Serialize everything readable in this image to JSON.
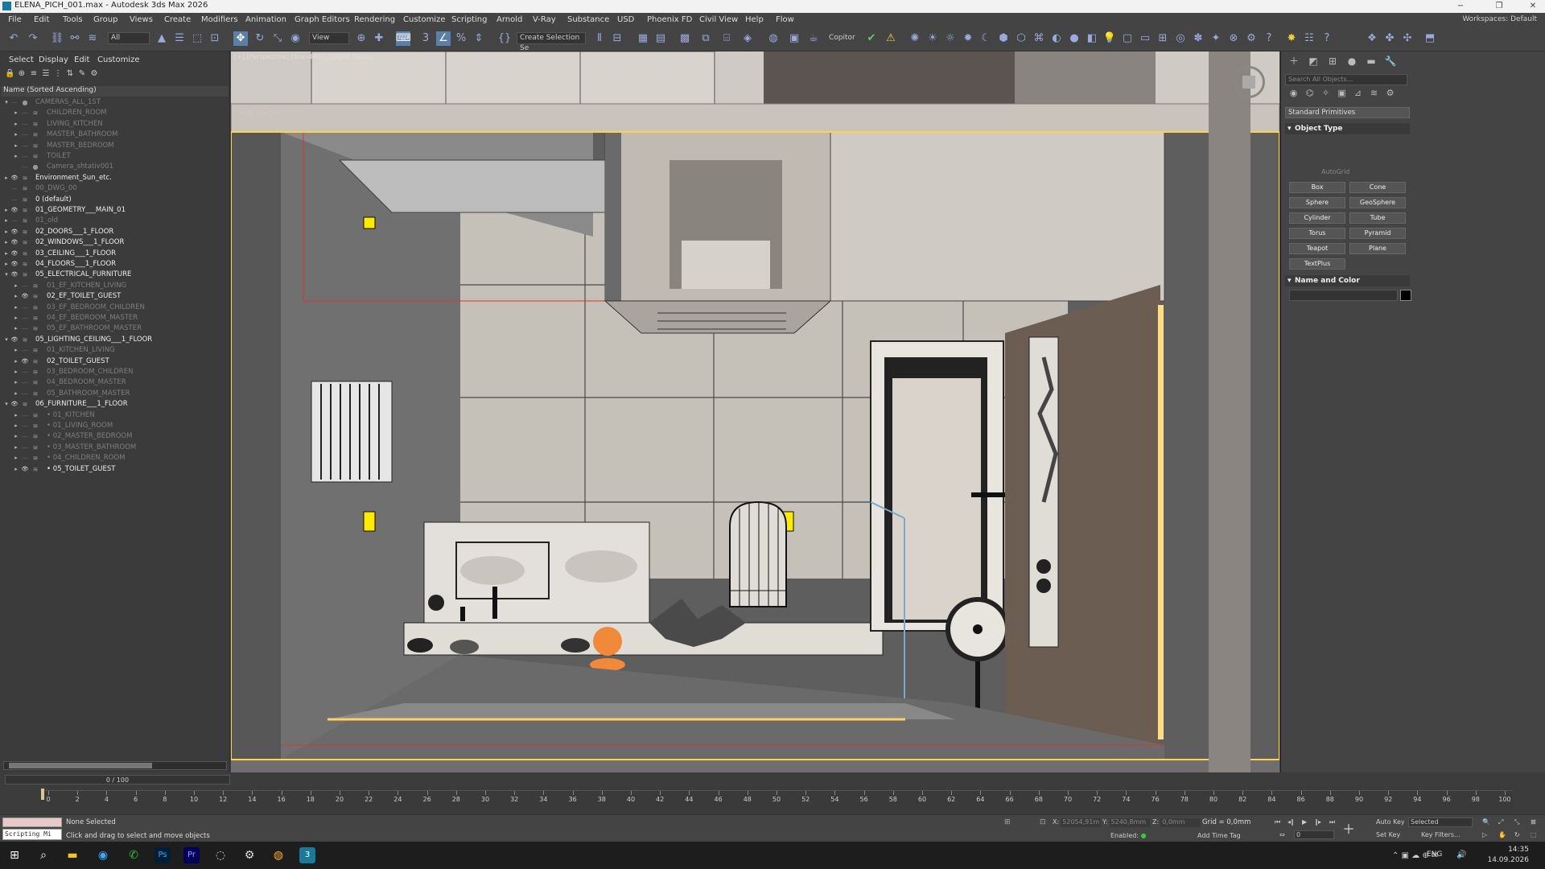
{
  "window": {
    "title": "ELENA_PICH_001.max - Autodesk 3ds Max 2026",
    "minimize": "−",
    "restore": "❐",
    "close": "✕"
  },
  "menu": [
    "File",
    "Edit",
    "Tools",
    "Group",
    "Views",
    "Create",
    "Modifiers",
    "Animation",
    "Graph Editors",
    "Rendering",
    "Customize",
    "Scripting",
    "Arnold",
    "V-Ray",
    "Substance",
    "USD",
    "Phoenix FD",
    "Civil View",
    "Help",
    "Flow"
  ],
  "workspace": {
    "label": "Workspaces:",
    "value": "Default"
  },
  "toolbar": {
    "selection_filter": "All",
    "ref_coord": "View",
    "named_selection": "Create Selection Se",
    "copitor": "Copitor"
  },
  "scene_explorer": {
    "tabs": [
      "Select",
      "Display",
      "Edit",
      "Customize"
    ],
    "sort_label": "Name (Sorted Ascending)",
    "rows": [
      {
        "name": "CAMERAS_ALL_1ST",
        "indent": 1,
        "dim": true,
        "exp": "▾",
        "eye": false,
        "icon": "camera"
      },
      {
        "name": "CHILDREN_ROOM",
        "indent": 2,
        "dim": true,
        "exp": "▸",
        "eye": false,
        "icon": "layer"
      },
      {
        "name": "LIVING_KITCHEN",
        "indent": 2,
        "dim": true,
        "exp": "▸",
        "eye": false,
        "icon": "layer"
      },
      {
        "name": "MASTER_BATHROOM",
        "indent": 2,
        "dim": true,
        "exp": "▸",
        "eye": false,
        "icon": "layer"
      },
      {
        "name": "MASTER_BEDROOM",
        "indent": 2,
        "dim": true,
        "exp": "▸",
        "eye": false,
        "icon": "layer"
      },
      {
        "name": "TOILET",
        "indent": 2,
        "dim": true,
        "exp": "▸",
        "eye": false,
        "icon": "layer"
      },
      {
        "name": "Camera_shtativ001",
        "indent": 2,
        "dim": true,
        "exp": "",
        "eye": false,
        "icon": "camera"
      },
      {
        "name": "Environment_Sun_etc.",
        "indent": 1,
        "dim": false,
        "exp": "▸",
        "eye": true,
        "icon": "layer"
      },
      {
        "name": "00_DWG_00",
        "indent": 1,
        "dim": true,
        "exp": "",
        "eye": false,
        "icon": "layer"
      },
      {
        "name": "0 (default)",
        "indent": 1,
        "dim": false,
        "exp": "",
        "eye": false,
        "icon": "layer"
      },
      {
        "name": "01_GEOMETRY___MAIN_01",
        "indent": 1,
        "dim": false,
        "exp": "▸",
        "eye": true,
        "icon": "layer"
      },
      {
        "name": "01_old",
        "indent": 1,
        "dim": true,
        "exp": "▸",
        "eye": false,
        "icon": "layer"
      },
      {
        "name": "02_DOORS___1_FLOOR",
        "indent": 1,
        "dim": false,
        "exp": "▸",
        "eye": true,
        "icon": "layer"
      },
      {
        "name": "02_WINDOWS___1_FLOOR",
        "indent": 1,
        "dim": false,
        "exp": "▸",
        "eye": true,
        "icon": "layer"
      },
      {
        "name": "03_CEILING___1_FLOOR",
        "indent": 1,
        "dim": false,
        "exp": "▸",
        "eye": true,
        "icon": "layer"
      },
      {
        "name": "04_FLOORS___1_FLOOR",
        "indent": 1,
        "dim": false,
        "exp": "▸",
        "eye": true,
        "icon": "layer"
      },
      {
        "name": "05_ELECTRICAL_FURNITURE",
        "indent": 1,
        "dim": false,
        "exp": "▾",
        "eye": true,
        "icon": "layer"
      },
      {
        "name": "01_EF_KITCHEN_LIVING",
        "indent": 2,
        "dim": true,
        "exp": "▸",
        "eye": false,
        "icon": "layer"
      },
      {
        "name": "02_EF_TOILET_GUEST",
        "indent": 2,
        "dim": false,
        "exp": "▸",
        "eye": true,
        "icon": "layer"
      },
      {
        "name": "03_EF_BEDROOM_CHILDREN",
        "indent": 2,
        "dim": true,
        "exp": "▸",
        "eye": false,
        "icon": "layer"
      },
      {
        "name": "04_EF_BEDROOM_MASTER",
        "indent": 2,
        "dim": true,
        "exp": "▸",
        "eye": false,
        "icon": "layer"
      },
      {
        "name": "05_EF_BATHROOM_MASTER",
        "indent": 2,
        "dim": true,
        "exp": "▸",
        "eye": false,
        "icon": "layer"
      },
      {
        "name": "05_LIGHTING_CEILING___1_FLOOR",
        "indent": 1,
        "dim": false,
        "exp": "▾",
        "eye": true,
        "icon": "layer"
      },
      {
        "name": "01_KITCHEN_LIVING",
        "indent": 2,
        "dim": true,
        "exp": "▸",
        "eye": false,
        "icon": "layer"
      },
      {
        "name": "02_TOILET_GUEST",
        "indent": 2,
        "dim": false,
        "exp": "▸",
        "eye": true,
        "icon": "layer"
      },
      {
        "name": "03_BEDROOM_CHILDREN",
        "indent": 2,
        "dim": true,
        "exp": "▸",
        "eye": false,
        "icon": "layer"
      },
      {
        "name": "04_BEDROOM_MASTER",
        "indent": 2,
        "dim": true,
        "exp": "▸",
        "eye": false,
        "icon": "layer"
      },
      {
        "name": "05_BATHROOM_MASTER",
        "indent": 2,
        "dim": true,
        "exp": "▸",
        "eye": false,
        "icon": "layer"
      },
      {
        "name": "06_FURNITURE___1_FLOOR",
        "indent": 1,
        "dim": false,
        "exp": "▾",
        "eye": true,
        "icon": "layer"
      },
      {
        "name": "• 01_KITCHEN",
        "indent": 2,
        "dim": true,
        "exp": "▸",
        "eye": false,
        "icon": "layer"
      },
      {
        "name": "• 01_LIVING_ROOM",
        "indent": 2,
        "dim": true,
        "exp": "▸",
        "eye": false,
        "icon": "layer"
      },
      {
        "name": "• 02_MASTER_BEDROOM",
        "indent": 2,
        "dim": true,
        "exp": "▸",
        "eye": false,
        "icon": "layer"
      },
      {
        "name": "• 03_MASTER_BATHROOM",
        "indent": 2,
        "dim": true,
        "exp": "▸",
        "eye": false,
        "icon": "layer"
      },
      {
        "name": "• 04_CHILDREN_ROOM",
        "indent": 2,
        "dim": true,
        "exp": "▸",
        "eye": false,
        "icon": "layer"
      },
      {
        "name": "• 05_TOILET_GUEST",
        "indent": 2,
        "dim": false,
        "exp": "▸",
        "eye": true,
        "icon": "layer"
      }
    ]
  },
  "viewport": {
    "label": "[+] [Perspective] [Standard] [Edged Faces]",
    "stats_total": "Total",
    "stats_polys": "Polys:  976 404",
    "stats_verts": "Verts:  958 874",
    "fps": "FPS:     Inactive"
  },
  "command_panel": {
    "search_placeholder": "Search All Objects...",
    "category": "Standard Primitives",
    "rollout_object_type": "Object Type",
    "autogrid": "AutoGrid",
    "buttons": [
      "Box",
      "Cone",
      "Sphere",
      "GeoSphere",
      "Cylinder",
      "Tube",
      "Torus",
      "Pyramid",
      "Teapot",
      "Plane",
      "TextPlus"
    ],
    "rollout_name_color": "Name and Color",
    "object_color": "#000000"
  },
  "timeline": {
    "frame_counter": "0 / 100",
    "ticks": [
      "0",
      "2",
      "4",
      "6",
      "8",
      "10",
      "12",
      "14",
      "16",
      "18",
      "20",
      "22",
      "24",
      "26",
      "28",
      "30",
      "32",
      "34",
      "36",
      "38",
      "40",
      "42",
      "44",
      "46",
      "48",
      "50",
      "52",
      "54",
      "56",
      "58",
      "60",
      "62",
      "64",
      "66",
      "68",
      "70",
      "72",
      "74",
      "76",
      "78",
      "80",
      "82",
      "84",
      "86",
      "88",
      "90",
      "92",
      "94",
      "96",
      "98",
      "100"
    ]
  },
  "status": {
    "maxscript": "Scripting Mi",
    "selection": "None Selected",
    "prompt": "Click and drag to select and move objects",
    "x_label": "X:",
    "x_value": "52054,91m",
    "y_label": "Y:",
    "y_value": "5240,8mm",
    "z_label": "Z:",
    "z_value": "0,0mm",
    "grid": "Grid = 0,0mm",
    "enabled": "Enabled:",
    "add_time_tag": "Add Time Tag",
    "auto_key": "Auto Key",
    "set_key": "Set Key",
    "key_mode": "Selected",
    "key_filters": "Key Filters...",
    "frame_field": "0"
  },
  "taskbar": {
    "language": "ENG",
    "time": "14:35",
    "date": "14.09.2026"
  }
}
